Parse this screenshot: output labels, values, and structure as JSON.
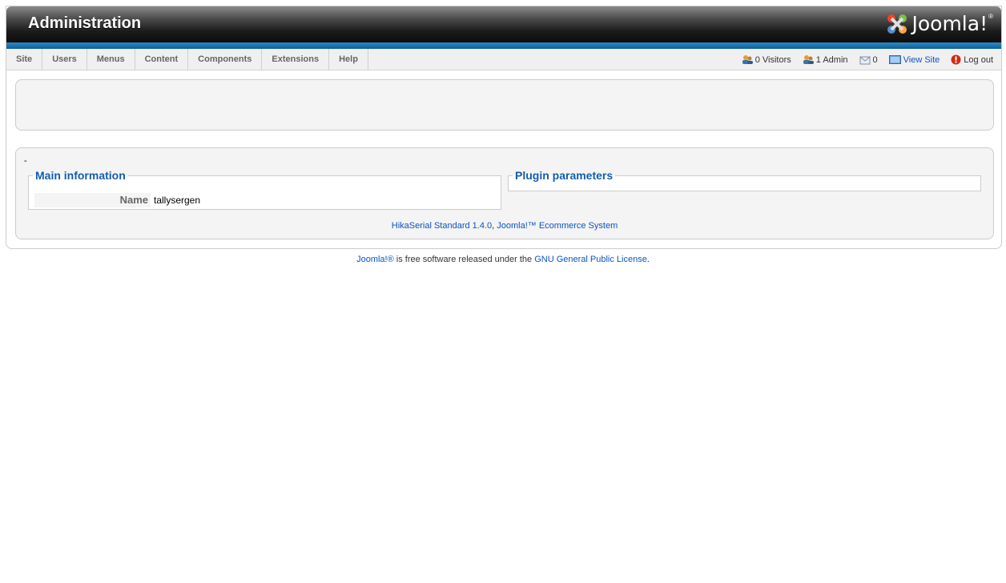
{
  "header": {
    "title": "Administration",
    "logo_text": "Joomla!",
    "logo_mark": "®"
  },
  "menu": {
    "items": [
      {
        "label": "Site"
      },
      {
        "label": "Users"
      },
      {
        "label": "Menus"
      },
      {
        "label": "Content"
      },
      {
        "label": "Components"
      },
      {
        "label": "Extensions"
      },
      {
        "label": "Help"
      }
    ]
  },
  "status": {
    "visitors": "0 Visitors",
    "admins": "1 Admin",
    "messages": "0",
    "view_site": "View Site",
    "logout": "Log out"
  },
  "content": {
    "dash": "-",
    "main_legend": "Main information",
    "name_key": "Name",
    "name_value": "tallysergen",
    "plugin_legend": "Plugin parameters",
    "credit_product": "HikaSerial Standard 1.4.0",
    "credit_sep": ", ",
    "credit_system": "Joomla!™ Ecommerce System"
  },
  "footer": {
    "joomla_link": "Joomla!®",
    "middle_text": " is free software released under the ",
    "license_link": "GNU General Public License",
    "end_text": "."
  },
  "colors": {
    "accent_blue": "#135cae",
    "bar_blue": "#0e5f97",
    "link": "#0b55c4"
  }
}
